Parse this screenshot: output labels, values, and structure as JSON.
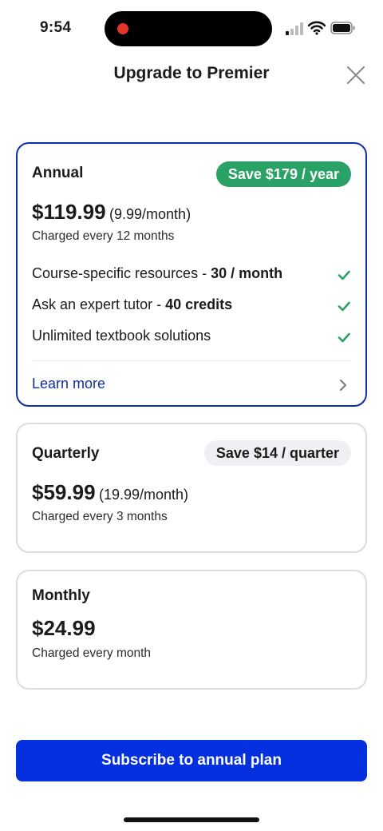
{
  "status_bar": {
    "time": "9:54"
  },
  "header": {
    "title": "Upgrade to Premier"
  },
  "colors": {
    "accent": "#0530e0",
    "selected_border": "#0f2ea8",
    "save_badge_green": "#2aa165",
    "check_green": "#2aa165"
  },
  "plans": [
    {
      "name": "Annual",
      "badge": "Save $179 / year",
      "price": "$119.99",
      "per_month": "(9.99/month)",
      "charged": "Charged every 12 months",
      "selected": true,
      "features": [
        {
          "text": "Course-specific resources - ",
          "bold": "30 / month",
          "icon": "check-icon"
        },
        {
          "text": "Ask an expert tutor - ",
          "bold": "40 credits",
          "icon": "check-icon"
        },
        {
          "text": "Unlimited textbook solutions",
          "bold": "",
          "icon": "check-icon"
        }
      ],
      "learn_more": "Learn more"
    },
    {
      "name": "Quarterly",
      "badge": "Save $14 / quarter",
      "price": "$59.99",
      "per_month": "(19.99/month)",
      "charged": "Charged every 3 months",
      "selected": false
    },
    {
      "name": "Monthly",
      "price": "$24.99",
      "charged": "Charged every month",
      "selected": false
    }
  ],
  "subscribe_button": "Subscribe to annual plan"
}
